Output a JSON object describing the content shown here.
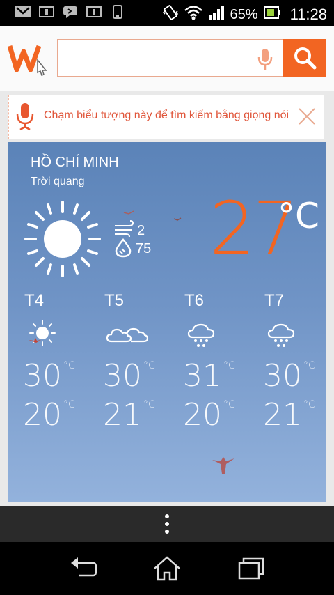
{
  "status_bar": {
    "battery_percent": "65%",
    "time": "11:28",
    "icons": [
      "gmail-icon",
      "notification-icon",
      "messenger-icon",
      "notification-icon",
      "phone-icon",
      "vibrate-icon",
      "wifi-icon",
      "signal-icon",
      "battery-icon"
    ]
  },
  "search": {
    "placeholder": "",
    "logo": "w-logo-icon",
    "accent_color": "#f26522"
  },
  "hint": {
    "text": "Chạm biểu tượng này để tìm kiếm bằng giọng nói"
  },
  "weather": {
    "city": "HỒ CHÍ MINH",
    "condition": "Trời quang",
    "wind": "2",
    "humidity": "75",
    "temperature": "27",
    "unit": "°C",
    "forecast": [
      {
        "day": "T4",
        "icon": "sunny-icon",
        "high": "30",
        "low": "20",
        "unit": "°C"
      },
      {
        "day": "T5",
        "icon": "cloudy-icon",
        "high": "30",
        "low": "21",
        "unit": "°C"
      },
      {
        "day": "T6",
        "icon": "rain-icon",
        "high": "31",
        "low": "20",
        "unit": "°C"
      },
      {
        "day": "T7",
        "icon": "rain-icon",
        "high": "30",
        "low": "21",
        "unit": "°C"
      }
    ]
  },
  "navigation": {
    "buttons": [
      "back-icon",
      "home-icon",
      "recents-icon"
    ]
  }
}
